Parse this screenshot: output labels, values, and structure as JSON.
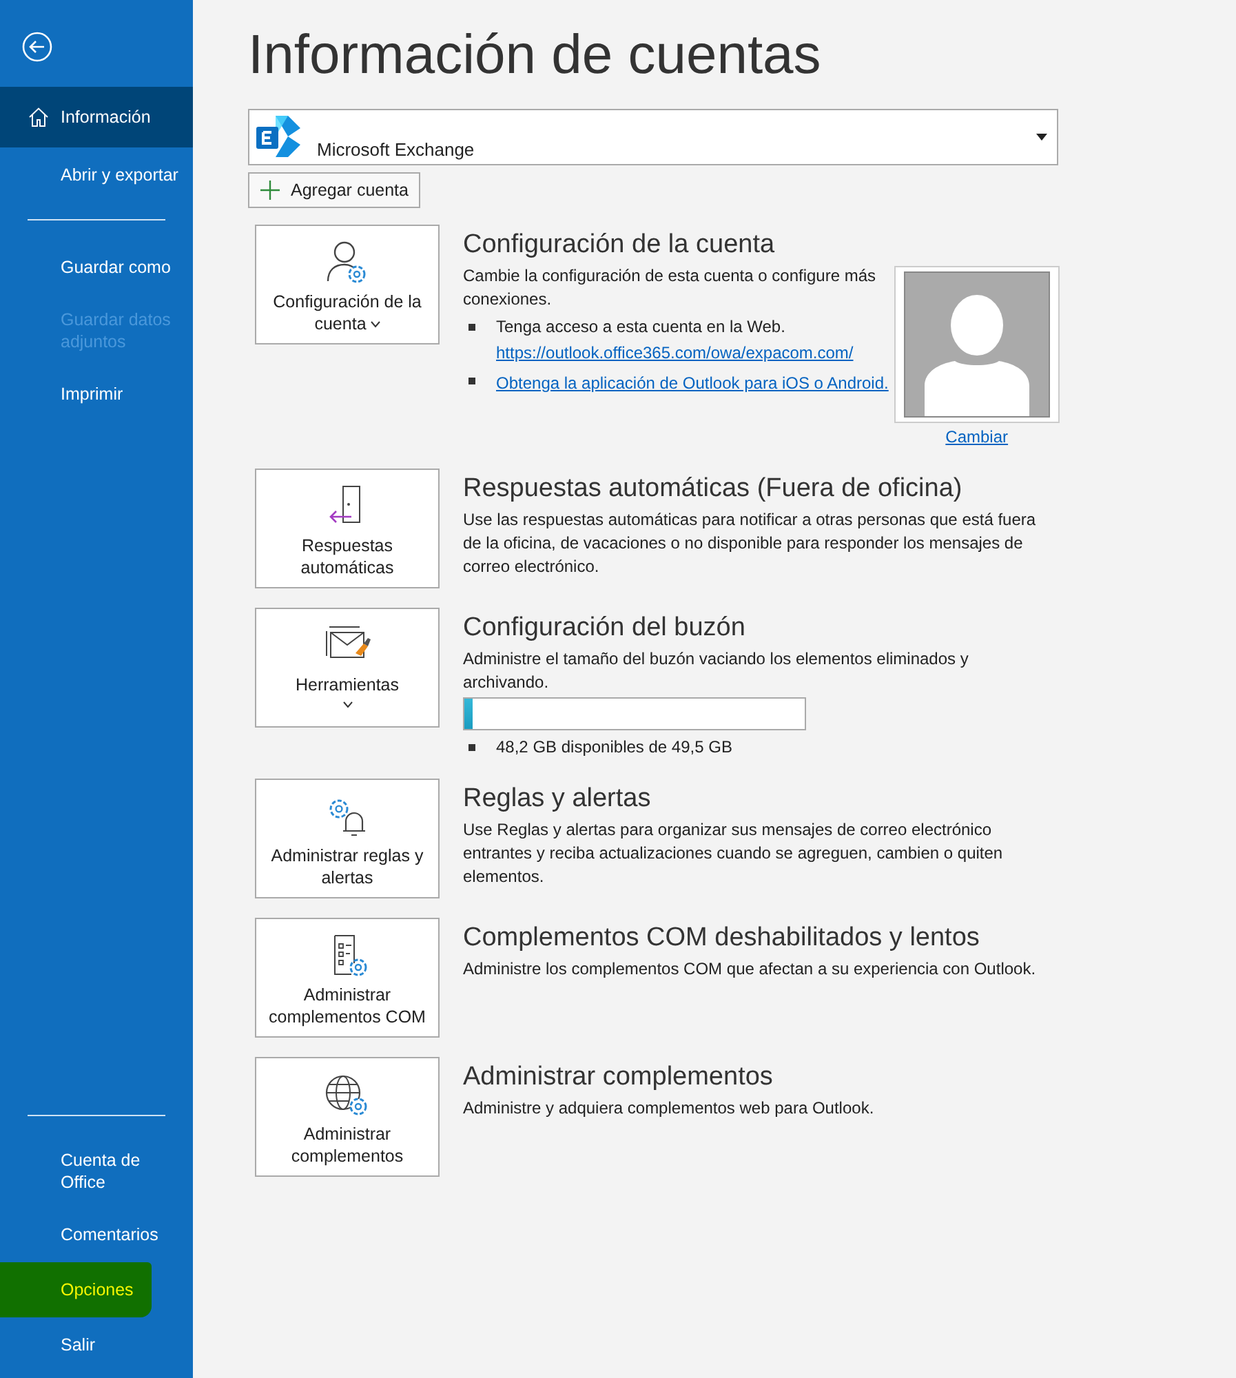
{
  "sidebar": {
    "groups": [
      [
        {
          "label": "Información",
          "selected": true,
          "disabled": false,
          "highlighted": false
        },
        {
          "label": "Abrir y exportar",
          "selected": false,
          "disabled": false,
          "highlighted": false
        }
      ],
      [
        {
          "label": "Guardar como",
          "selected": false,
          "disabled": false,
          "highlighted": false
        },
        {
          "label": "Guardar datos adjuntos",
          "selected": false,
          "disabled": true,
          "highlighted": false
        },
        {
          "label": "Imprimir",
          "selected": false,
          "disabled": false,
          "highlighted": false
        }
      ]
    ],
    "bottom_items": [
      {
        "label": "Cuenta de Office",
        "selected": false,
        "disabled": false,
        "highlighted": false
      },
      {
        "label": "Comentarios",
        "selected": false,
        "disabled": false,
        "highlighted": false
      },
      {
        "label": "Opciones",
        "selected": false,
        "disabled": false,
        "highlighted": true
      },
      {
        "label": "Salir",
        "selected": false,
        "disabled": false,
        "highlighted": false
      }
    ]
  },
  "title": "Información de cuentas",
  "account_select": {
    "value": "Microsoft Exchange"
  },
  "add_account_button": "Agregar cuenta",
  "sections": [
    {
      "kind": "account",
      "button_label": "Configuración de la cuenta",
      "dropdown": true,
      "heading": "Configuración de la cuenta",
      "description": "Cambie la configuración de esta cuenta o configure más conexiones.",
      "bullets": [
        {
          "text": "Tenga acceso a esta cuenta en la Web.",
          "link": "https://outlook.office365.com/owa/expacom.com/"
        },
        {
          "link": "Obtenga la aplicación de Outlook para iOS o Android."
        }
      ],
      "photo_link": "Cambiar"
    },
    {
      "kind": "text",
      "button_label": "Respuestas automáticas",
      "dropdown": false,
      "heading": "Respuestas automáticas (Fuera de oficina)",
      "description": "Use las respuestas automáticas para notificar a otras personas que está fuera de la oficina, de vacaciones o no disponible para responder los mensajes de correo electrónico."
    },
    {
      "kind": "storage",
      "button_label": "Herramientas",
      "dropdown": true,
      "heading": "Configuración del buzón",
      "description": "Administre el tamaño del buzón vaciando los elementos eliminados y archivando.",
      "level": 0.026,
      "reading": "48,2 GB disponibles de 49,5 GB"
    },
    {
      "kind": "text",
      "button_label": "Administrar reglas y alertas",
      "dropdown": false,
      "heading": "Reglas y alertas",
      "description": "Use Reglas y alertas para organizar sus mensajes de correo electrónico entrantes y reciba actualizaciones cuando se agreguen, cambien o quiten elementos."
    },
    {
      "kind": "text",
      "button_label": "Administrar complementos COM",
      "dropdown": false,
      "heading": "Complementos COM deshabilitados y lentos",
      "description": "Administre los complementos COM que afectan a su experiencia con Outlook."
    },
    {
      "kind": "text",
      "button_label": "Administrar complementos",
      "dropdown": false,
      "heading": "Administrar complementos",
      "description": "Administre y adquiera complementos web para Outlook."
    }
  ]
}
